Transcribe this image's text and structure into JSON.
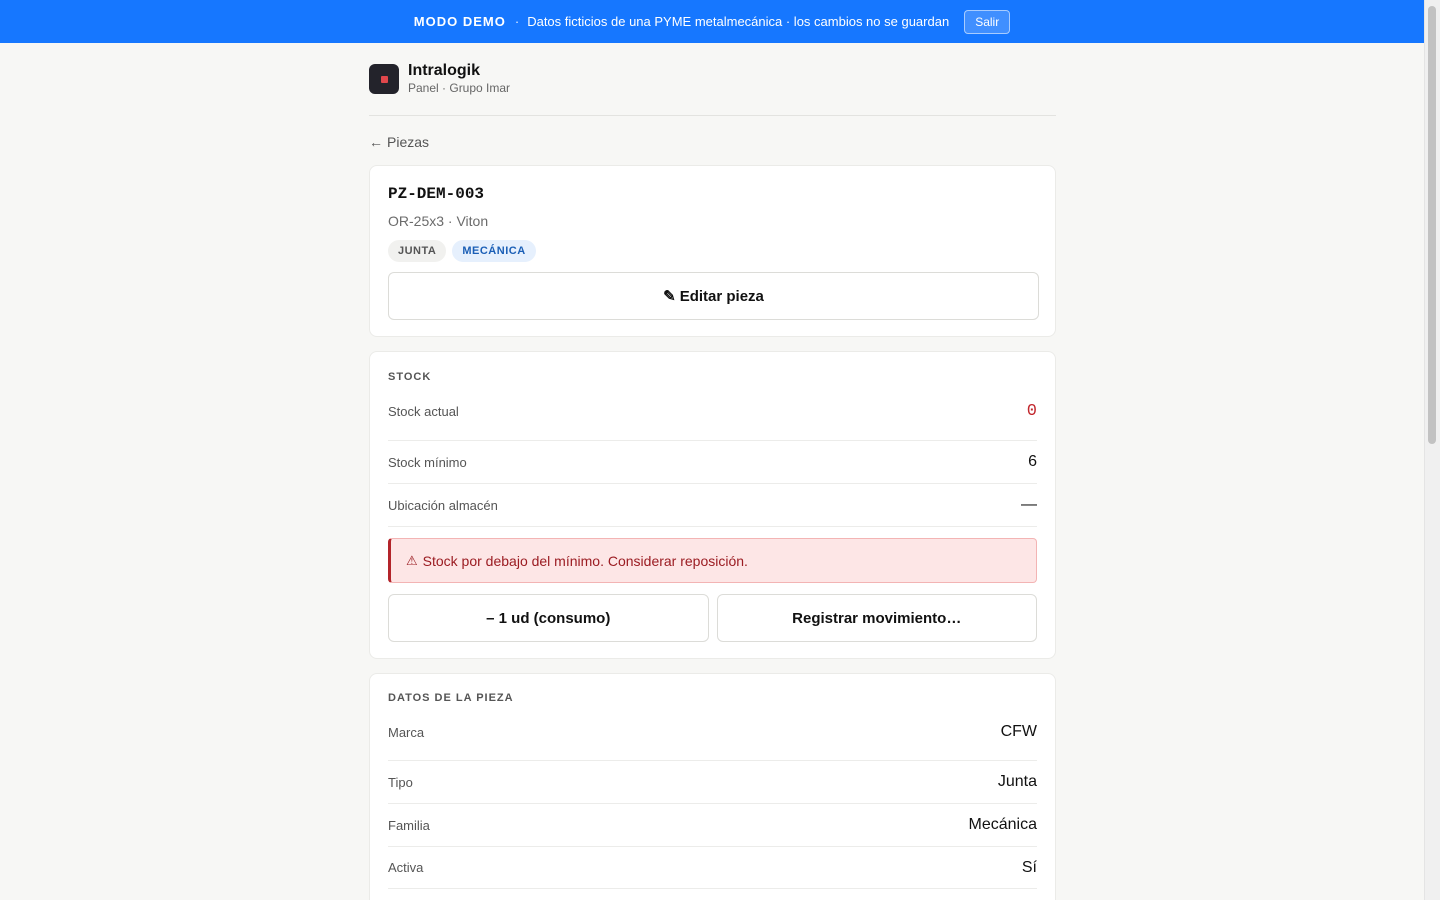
{
  "banner": {
    "tag": "MODO DEMO",
    "separator": "·",
    "message": "Datos ficticios de una PYME metalmecánica · los cambios no se guardan",
    "exit_label": "Salir"
  },
  "brand": {
    "name": "Intralogik",
    "subtitle": "Panel · Grupo Imar",
    "logo_icon": "app-logo-icon"
  },
  "nav": {
    "back_arrow": "←",
    "back_label": "Piezas"
  },
  "piece": {
    "code": "PZ-DEM-003",
    "description": "OR-25x3 · Viton",
    "tags": [
      "JUNTA",
      "MECÁNICA"
    ],
    "edit_icon": "✎",
    "edit_label": "Editar pieza"
  },
  "stock": {
    "title": "STOCK",
    "rows": [
      {
        "label": "Stock actual",
        "value": "0"
      },
      {
        "label": "Stock mínimo",
        "value": "6"
      },
      {
        "label": "Ubicación almacén",
        "value": "—"
      }
    ],
    "alert_icon": "⚠",
    "alert": "Stock por debajo del mínimo. Considerar reposición.",
    "consume_label": "– 1 ud (consumo)",
    "register_label": "Registrar movimiento…"
  },
  "details": {
    "title": "DATOS DE LA PIEZA",
    "rows": [
      {
        "label": "Marca",
        "value": "CFW"
      },
      {
        "label": "Tipo",
        "value": "Junta"
      },
      {
        "label": "Familia",
        "value": "Mecánica"
      },
      {
        "label": "Activa",
        "value": "Sí"
      }
    ]
  },
  "colors": {
    "banner": "#1677ff",
    "danger": "#c2272d",
    "tag_blue_text": "#1b5fb6"
  }
}
